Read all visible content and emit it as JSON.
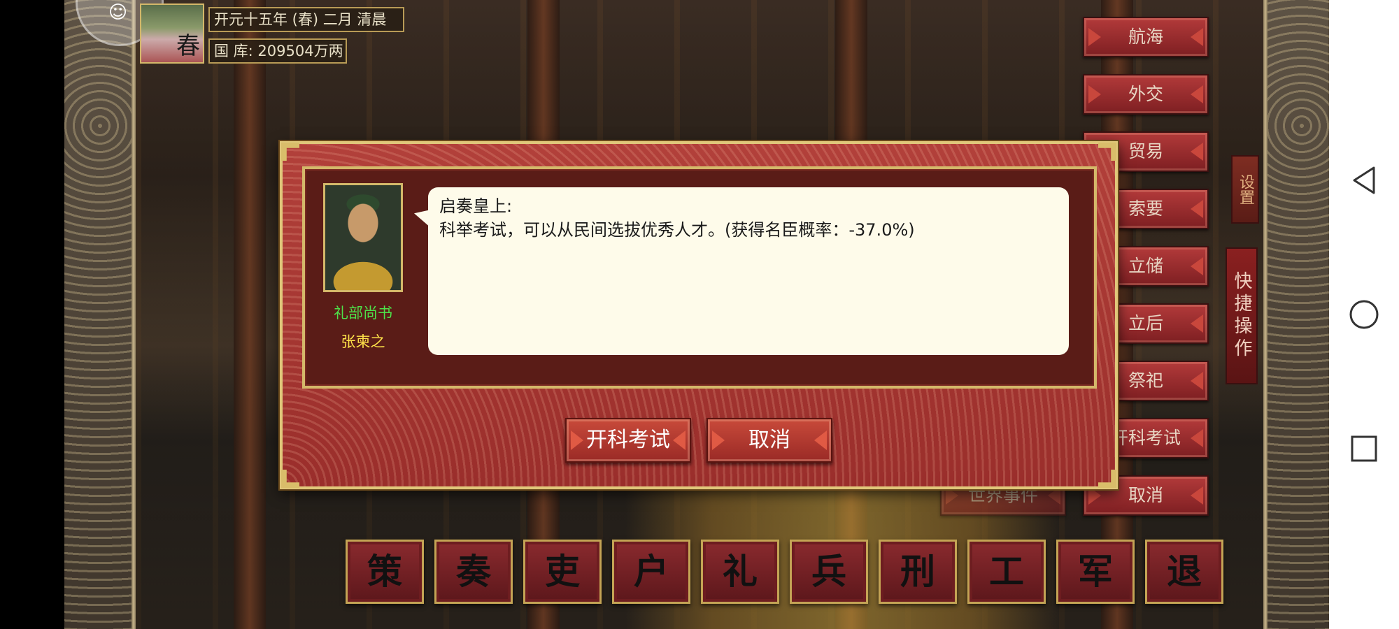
{
  "top_info": {
    "season_char": "春",
    "date": "开元十五年 (春) 二月 清晨",
    "treasury": "国 库: 209504万两"
  },
  "right_menu": {
    "items": [
      "航海",
      "外交",
      "贸易",
      "索要",
      "立储",
      "立后",
      "祭祀",
      "开科考试",
      "取消"
    ],
    "world_events": "世界事件",
    "settings": "设置",
    "quick_ops": "快捷操作"
  },
  "bottom_bar": {
    "items": [
      "策",
      "奏",
      "吏",
      "户",
      "礼",
      "兵",
      "刑",
      "工",
      "军",
      "退"
    ]
  },
  "dialog": {
    "minister_title": "礼部尚书",
    "minister_name": "张柬之",
    "speech_line1": "启奏皇上:",
    "speech_line2": "科举考试，可以从民间选拔优秀人才。(获得名臣概率：-37.0%)",
    "confirm_label": "开科考试",
    "cancel_label": "取消"
  },
  "nav_bar": {
    "icons": [
      "back-icon",
      "home-icon",
      "recents-icon"
    ]
  },
  "colors": {
    "minister_title": "#4ee24a",
    "minister_name": "#ffe34a",
    "dialog_bg": "#9a2e2b",
    "gold_border": "#d4b86a"
  }
}
